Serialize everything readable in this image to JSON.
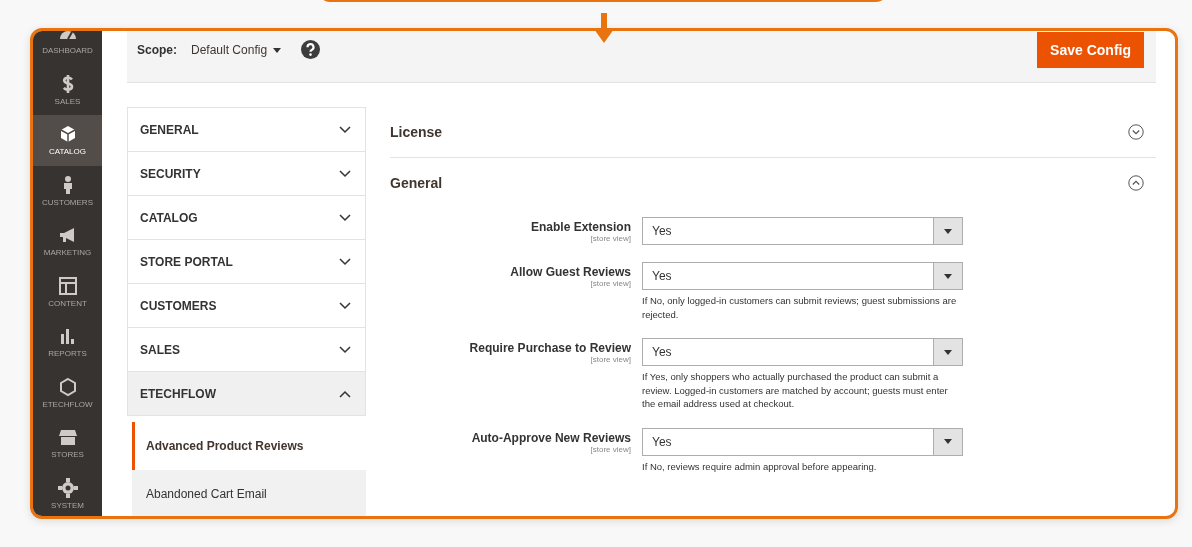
{
  "menu": [
    {
      "label": "DASHBOARD",
      "selected": false
    },
    {
      "label": "SALES",
      "selected": false
    },
    {
      "label": "CATALOG",
      "selected": true
    },
    {
      "label": "CUSTOMERS",
      "selected": false
    },
    {
      "label": "MARKETING",
      "selected": false
    },
    {
      "label": "CONTENT",
      "selected": false
    },
    {
      "label": "REPORTS",
      "selected": false
    },
    {
      "label": "ETECHFLOW",
      "selected": false
    },
    {
      "label": "STORES",
      "selected": false
    },
    {
      "label": "SYSTEM",
      "selected": false
    }
  ],
  "scope": {
    "label": "Scope:",
    "value": "Default Config"
  },
  "save_button": "Save Config",
  "config_nav": [
    {
      "label": "GENERAL",
      "expanded": false
    },
    {
      "label": "SECURITY",
      "expanded": false
    },
    {
      "label": "CATALOG",
      "expanded": false
    },
    {
      "label": "STORE PORTAL",
      "expanded": false
    },
    {
      "label": "CUSTOMERS",
      "expanded": false
    },
    {
      "label": "SALES",
      "expanded": false
    },
    {
      "label": "ETECHFLOW",
      "expanded": true,
      "children": [
        {
          "label": "Advanced Product Reviews",
          "selected": true
        },
        {
          "label": "Abandoned Cart Email",
          "selected": false
        }
      ]
    }
  ],
  "groups": [
    {
      "title": "License",
      "expanded": false
    },
    {
      "title": "General",
      "expanded": true,
      "fields": [
        {
          "label": "Enable Extension",
          "scope": "[store view]",
          "value": "Yes"
        },
        {
          "label": "Allow Guest Reviews",
          "scope": "[store view]",
          "value": "Yes",
          "comment": "If No, only logged-in customers can submit reviews; guest submissions are rejected."
        },
        {
          "label": "Require Purchase to Review",
          "scope": "[store view]",
          "value": "Yes",
          "comment": "If Yes, only shoppers who actually purchased the product can submit a review. Logged-in customers are matched by account; guests must enter the email address used at checkout."
        },
        {
          "label": "Auto-Approve New Reviews",
          "scope": "[store view]",
          "value": "Yes",
          "comment": "If No, reviews require admin approval before appearing."
        }
      ]
    }
  ]
}
